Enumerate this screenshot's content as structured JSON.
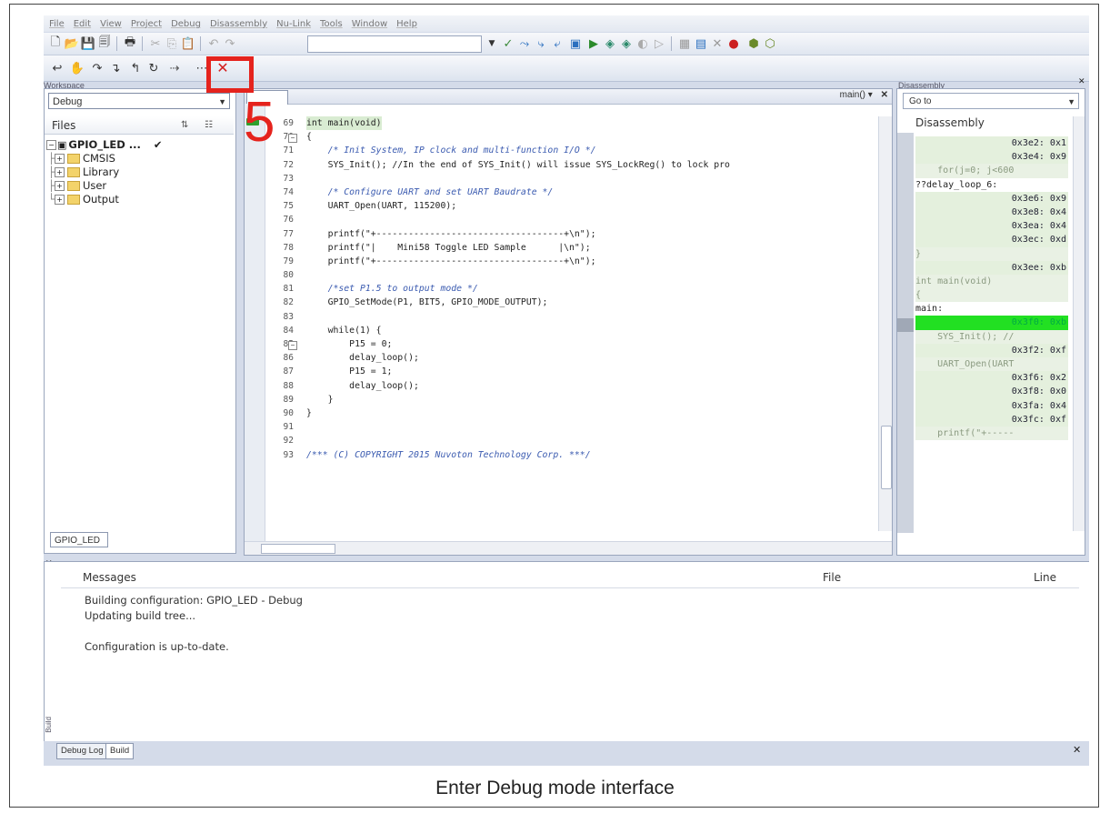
{
  "menu": [
    "File",
    "Edit",
    "View",
    "Project",
    "Debug",
    "Disassembly",
    "Nu-Link",
    "Tools",
    "Window",
    "Help"
  ],
  "workspace": {
    "panel_title": "Workspace",
    "config": "Debug",
    "files_header": "Files",
    "project": "GPIO_LED ...",
    "checkmark": "✔",
    "folders": [
      "CMSIS",
      "Library",
      "User",
      "Output"
    ],
    "tab": "GPIO_LED"
  },
  "editor": {
    "function_selector": "main()",
    "line_numbers": [
      "69",
      "70",
      "71",
      "72",
      "73",
      "74",
      "75",
      "76",
      "77",
      "78",
      "79",
      "80",
      "81",
      "82",
      "83",
      "84",
      "85",
      "86",
      "87",
      "88",
      "89",
      "90",
      "91",
      "92",
      "93"
    ],
    "code_lines": [
      {
        "code": "int main(void)",
        "cls": "hl"
      },
      {
        "code": "{",
        "cls": ""
      },
      {
        "code": "    /* Init System, IP clock and multi-function I/O */",
        "cls": "cmt"
      },
      {
        "code": "    SYS_Init(); //In the end of SYS_Init() will issue SYS_LockReg() to lock pro",
        "cls": ""
      },
      {
        "code": "",
        "cls": ""
      },
      {
        "code": "    /* Configure UART and set UART Baudrate */",
        "cls": "cmt"
      },
      {
        "code": "    UART_Open(UART, 115200);",
        "cls": ""
      },
      {
        "code": "",
        "cls": ""
      },
      {
        "code": "    printf(\"+-----------------------------------+\\n\");",
        "cls": ""
      },
      {
        "code": "    printf(\"|    Mini58 Toggle LED Sample      |\\n\");",
        "cls": ""
      },
      {
        "code": "    printf(\"+-----------------------------------+\\n\");",
        "cls": ""
      },
      {
        "code": "",
        "cls": ""
      },
      {
        "code": "    /*set P1.5 to output mode */",
        "cls": "cmt"
      },
      {
        "code": "    GPIO_SetMode(P1, BIT5, GPIO_MODE_OUTPUT);",
        "cls": ""
      },
      {
        "code": "",
        "cls": ""
      },
      {
        "code": "    while(1) {",
        "cls": ""
      },
      {
        "code": "        P15 = 0;",
        "cls": ""
      },
      {
        "code": "        delay_loop();",
        "cls": ""
      },
      {
        "code": "        P15 = 1;",
        "cls": ""
      },
      {
        "code": "        delay_loop();",
        "cls": ""
      },
      {
        "code": "    }",
        "cls": ""
      },
      {
        "code": "}",
        "cls": ""
      },
      {
        "code": "",
        "cls": ""
      },
      {
        "code": "",
        "cls": ""
      },
      {
        "code": "/*** (C) COPYRIGHT 2015 Nuvoton Technology Corp. ***/",
        "cls": "cmt"
      }
    ]
  },
  "disassembly": {
    "panel_title": "Disassembly",
    "goto": "Go to",
    "header": "Disassembly",
    "lines": [
      {
        "t": "0x3e2: 0x1",
        "k": ""
      },
      {
        "t": "0x3e4: 0x9",
        "k": ""
      },
      {
        "t": "    for(j=0; j<600",
        "k": "src"
      },
      {
        "t": "??delay_loop_6:",
        "k": "lbl"
      },
      {
        "t": "0x3e6: 0x9",
        "k": ""
      },
      {
        "t": "0x3e8: 0x4",
        "k": ""
      },
      {
        "t": "0x3ea: 0x4",
        "k": ""
      },
      {
        "t": "0x3ec: 0xd",
        "k": ""
      },
      {
        "t": "}",
        "k": "src"
      },
      {
        "t": "0x3ee: 0xb",
        "k": ""
      },
      {
        "t": "int main(void)",
        "k": "src"
      },
      {
        "t": "{",
        "k": "src"
      },
      {
        "t": "main:",
        "k": "lbl"
      },
      {
        "t": "0x3f0: 0xb",
        "k": "cur"
      },
      {
        "t": "    SYS_Init(); //",
        "k": "src"
      },
      {
        "t": "0x3f2: 0xf",
        "k": ""
      },
      {
        "t": "    UART_Open(UART",
        "k": "src"
      },
      {
        "t": "0x3f6: 0x2",
        "k": ""
      },
      {
        "t": "0x3f8: 0x0",
        "k": ""
      },
      {
        "t": "0x3fa: 0x4",
        "k": ""
      },
      {
        "t": "0x3fc: 0xf",
        "k": ""
      },
      {
        "t": "    printf(\"+-----",
        "k": "src"
      }
    ]
  },
  "messages": {
    "col_messages": "Messages",
    "col_file": "File",
    "col_line": "Line",
    "lines": [
      "Building configuration: GPIO_LED - Debug",
      "Updating build tree...",
      "",
      "Configuration is up-to-date."
    ],
    "side_label": "Build"
  },
  "bottom_tabs": [
    "Debug Log",
    "Build"
  ],
  "annotation": {
    "number": "5",
    "color": "#e5231d"
  },
  "caption": "Enter Debug mode interface"
}
